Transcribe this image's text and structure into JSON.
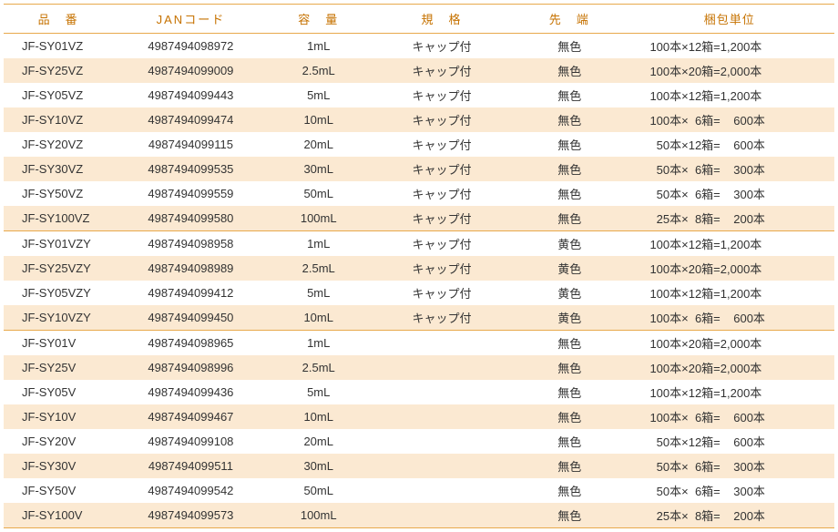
{
  "headers": {
    "part": "品　番",
    "jan": "JANコード",
    "volume": "容　量",
    "spec": "規　格",
    "tip": "先　端",
    "pack": "梱包単位"
  },
  "groups": [
    {
      "rows": [
        {
          "part": "JF-SY01VZ",
          "jan": "4987494098972",
          "volume": "1mL",
          "spec": "キャップ付",
          "tip": "無色",
          "pack": "100本×12箱=1,200本"
        },
        {
          "part": "JF-SY25VZ",
          "jan": "4987494099009",
          "volume": "2.5mL",
          "spec": "キャップ付",
          "tip": "無色",
          "pack": "100本×20箱=2,000本"
        },
        {
          "part": "JF-SY05VZ",
          "jan": "4987494099443",
          "volume": "5mL",
          "spec": "キャップ付",
          "tip": "無色",
          "pack": "100本×12箱=1,200本"
        },
        {
          "part": "JF-SY10VZ",
          "jan": "4987494099474",
          "volume": "10mL",
          "spec": "キャップ付",
          "tip": "無色",
          "pack": "100本× 6箱=  600本"
        },
        {
          "part": "JF-SY20VZ",
          "jan": "4987494099115",
          "volume": "20mL",
          "spec": "キャップ付",
          "tip": "無色",
          "pack": " 50本×12箱=  600本"
        },
        {
          "part": "JF-SY30VZ",
          "jan": "4987494099535",
          "volume": "30mL",
          "spec": "キャップ付",
          "tip": "無色",
          "pack": " 50本× 6箱=  300本"
        },
        {
          "part": "JF-SY50VZ",
          "jan": "4987494099559",
          "volume": "50mL",
          "spec": "キャップ付",
          "tip": "無色",
          "pack": " 50本× 6箱=  300本"
        },
        {
          "part": "JF-SY100VZ",
          "jan": "4987494099580",
          "volume": "100mL",
          "spec": "キャップ付",
          "tip": "無色",
          "pack": " 25本× 8箱=  200本"
        }
      ]
    },
    {
      "rows": [
        {
          "part": "JF-SY01VZY",
          "jan": "4987494098958",
          "volume": "1mL",
          "spec": "キャップ付",
          "tip": "黄色",
          "pack": "100本×12箱=1,200本"
        },
        {
          "part": "JF-SY25VZY",
          "jan": "4987494098989",
          "volume": "2.5mL",
          "spec": "キャップ付",
          "tip": "黄色",
          "pack": "100本×20箱=2,000本"
        },
        {
          "part": "JF-SY05VZY",
          "jan": "4987494099412",
          "volume": "5mL",
          "spec": "キャップ付",
          "tip": "黄色",
          "pack": "100本×12箱=1,200本"
        },
        {
          "part": "JF-SY10VZY",
          "jan": "4987494099450",
          "volume": "10mL",
          "spec": "キャップ付",
          "tip": "黄色",
          "pack": "100本× 6箱=  600本"
        }
      ]
    },
    {
      "rows": [
        {
          "part": "JF-SY01V",
          "jan": "4987494098965",
          "volume": "1mL",
          "spec": "",
          "tip": "無色",
          "pack": "100本×20箱=2,000本"
        },
        {
          "part": "JF-SY25V",
          "jan": "4987494098996",
          "volume": "2.5mL",
          "spec": "",
          "tip": "無色",
          "pack": "100本×20箱=2,000本"
        },
        {
          "part": "JF-SY05V",
          "jan": "4987494099436",
          "volume": "5mL",
          "spec": "",
          "tip": "無色",
          "pack": "100本×12箱=1,200本"
        },
        {
          "part": "JF-SY10V",
          "jan": "4987494099467",
          "volume": "10mL",
          "spec": "",
          "tip": "無色",
          "pack": "100本× 6箱=  600本"
        },
        {
          "part": "JF-SY20V",
          "jan": "4987494099108",
          "volume": "20mL",
          "spec": "",
          "tip": "無色",
          "pack": " 50本×12箱=  600本"
        },
        {
          "part": "JF-SY30V",
          "jan": "4987494099511",
          "volume": "30mL",
          "spec": "",
          "tip": "無色",
          "pack": " 50本× 6箱=  300本"
        },
        {
          "part": "JF-SY50V",
          "jan": "4987494099542",
          "volume": "50mL",
          "spec": "",
          "tip": "無色",
          "pack": " 50本× 6箱=  300本"
        },
        {
          "part": "JF-SY100V",
          "jan": "4987494099573",
          "volume": "100mL",
          "spec": "",
          "tip": "無色",
          "pack": " 25本× 8箱=  200本"
        }
      ]
    }
  ]
}
